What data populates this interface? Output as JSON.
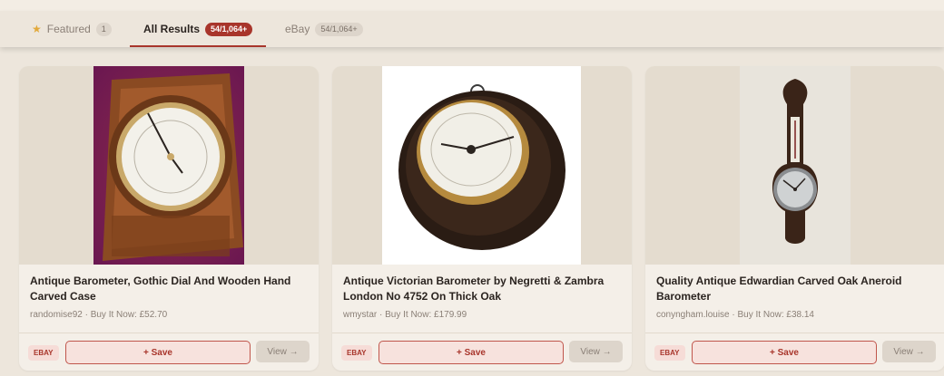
{
  "tabs": [
    {
      "label": "Featured",
      "count": "1",
      "icon": "star-icon"
    },
    {
      "label": "All Results",
      "count": "54/1,064+"
    },
    {
      "label": "eBay",
      "count": "54/1,064+"
    }
  ],
  "colors": {
    "accent": "#a8352b",
    "background": "#ede6dc",
    "card": "#f4efe8"
  },
  "listings": [
    {
      "title": "Antique Barometer, Gothic Dial And Wooden Hand Carved Case",
      "meta": "randomise92 · Buy It Now: £52.70",
      "source": "EBAY",
      "save": "+ Save",
      "view": "View →"
    },
    {
      "title": "Antique Victorian Barometer by Negretti & Zambra London No 4752 On Thick Oak",
      "meta": "wmystar · Buy It Now: £179.99",
      "source": "EBAY",
      "save": "+ Save",
      "view": "View →"
    },
    {
      "title": "Quality Antique Edwardian Carved Oak Aneroid Barometer",
      "meta": "conyngham.louise · Buy It Now: £38.14",
      "source": "EBAY",
      "save": "+ Save",
      "view": "View →"
    }
  ]
}
